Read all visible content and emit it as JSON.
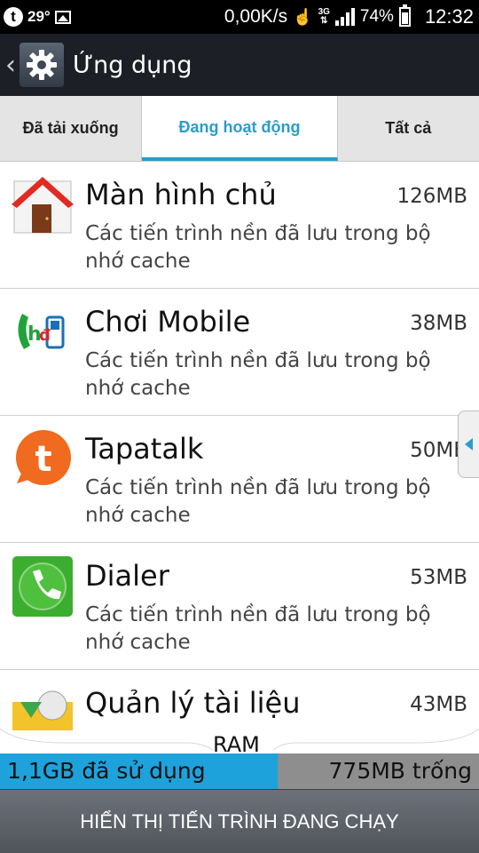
{
  "status_bar": {
    "notification_t": "t",
    "temperature": "29°",
    "net_speed": "0,00K/s",
    "network_type": "3G",
    "battery_percent": "74%",
    "battery_level": 0.74,
    "time": "12:32"
  },
  "action_bar": {
    "title": "Ứng dụng",
    "icon": "settings-gear-icon"
  },
  "tabs": [
    {
      "label": "Đã tải xuống",
      "active": false
    },
    {
      "label": "Đang hoạt động",
      "active": true
    },
    {
      "label": "Tất cả",
      "active": false
    }
  ],
  "accent_color": "#2b9dc9",
  "apps": [
    {
      "name": "Màn hình chủ",
      "size": "126MB",
      "desc": "Các tiến trình nền đã lưu trong bộ nhớ cache",
      "icon": "home-icon"
    },
    {
      "name": "Chơi Mobile",
      "size": "38MB",
      "desc": "Các tiến trình nền đã lưu trong bộ nhớ cache",
      "icon": "choi-mobile-icon"
    },
    {
      "name": "Tapatalk",
      "size": "50MB",
      "desc": "Các tiến trình nền đã lưu trong bộ nhớ cache",
      "icon": "tapatalk-icon"
    },
    {
      "name": "Dialer",
      "size": "53MB",
      "desc": "Các tiến trình nền đã lưu trong bộ nhớ cache",
      "icon": "dialer-phone-icon"
    },
    {
      "name": "Quản lý tài liệu",
      "size": "43MB",
      "desc": "",
      "icon": "file-manager-icon"
    }
  ],
  "ram": {
    "label": "RAM",
    "used_text": "1,1GB đã sử dụng",
    "free_text": "775MB trống",
    "used_fraction": 0.58
  },
  "bottom_button": {
    "label": "HIỂN THỊ TIẾN TRÌNH ĐANG CHẠY"
  }
}
